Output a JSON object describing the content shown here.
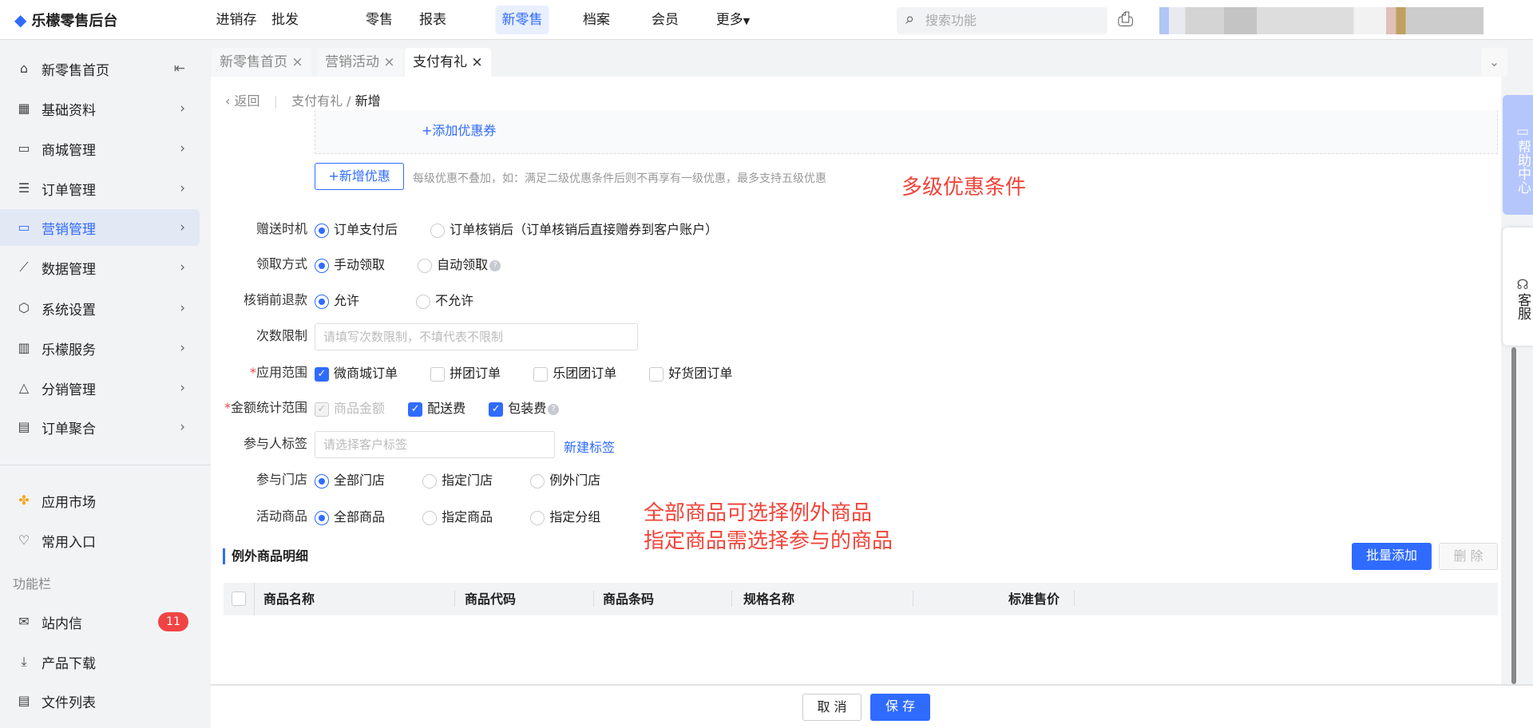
{
  "header": {
    "logo": "乐檬零售后台",
    "nav": [
      "进销存",
      "批发",
      "零售",
      "报表",
      "新零售",
      "档案",
      "会员",
      "更多"
    ],
    "active_nav": "新零售",
    "search_placeholder": "搜索功能"
  },
  "sidebar": {
    "items": [
      {
        "label": "新零售首页",
        "icon": "home-icon"
      },
      {
        "label": "基础资料",
        "icon": "grid-icon"
      },
      {
        "label": "商城管理",
        "icon": "store-icon"
      },
      {
        "label": "订单管理",
        "icon": "list-icon"
      },
      {
        "label": "营销管理",
        "icon": "monitor-icon"
      },
      {
        "label": "数据管理",
        "icon": "chart-icon"
      },
      {
        "label": "系统设置",
        "icon": "settings-icon"
      },
      {
        "label": "乐檬服务",
        "icon": "briefcase-icon"
      },
      {
        "label": "分销管理",
        "icon": "share-icon"
      },
      {
        "label": "订单聚合",
        "icon": "aggregate-icon"
      }
    ],
    "active": "营销管理",
    "extra": [
      {
        "label": "应用市场"
      },
      {
        "label": "常用入口"
      }
    ],
    "section": "功能栏",
    "tools": [
      {
        "label": "站内信",
        "badge": "11"
      },
      {
        "label": "产品下载"
      },
      {
        "label": "文件列表"
      }
    ]
  },
  "tabs": [
    {
      "label": "新零售首页"
    },
    {
      "label": "营销活动"
    },
    {
      "label": "支付有礼"
    }
  ],
  "breadcrumb": {
    "back": "返回",
    "parent": "支付有礼",
    "current": "新增"
  },
  "coupon": {
    "add_coupon": "+添加优惠券",
    "add_discount": "+新增优惠",
    "hint": "每级优惠不叠加，如：满足二级优惠条件后则不再享有一级优惠，最多支持五级优惠"
  },
  "annotations": {
    "a1": "多级优惠条件",
    "a2": "全部商品可选择例外商品",
    "a3": "指定商品需选择参与的商品"
  },
  "form": {
    "gift_timing": {
      "label": "赠送时机",
      "options": [
        "订单支付后",
        "订单核销后（订单核销后直接赠券到客户账户）"
      ],
      "selected": 0
    },
    "claim_method": {
      "label": "领取方式",
      "options": [
        "手动领取",
        "自动领取"
      ],
      "selected": 0
    },
    "refund": {
      "label": "核销前退款",
      "options": [
        "允许",
        "不允许"
      ],
      "selected": 0
    },
    "limit": {
      "label": "次数限制",
      "placeholder": "请填写次数限制，不填代表不限制"
    },
    "scope": {
      "label": "应用范围",
      "options": [
        "微商城订单",
        "拼团订单",
        "乐团团订单",
        "好货团订单"
      ],
      "checked": [
        true,
        false,
        false,
        false
      ]
    },
    "amount": {
      "label": "金额统计范围",
      "options": [
        "商品金额",
        "配送费",
        "包装费"
      ],
      "checked": [
        true,
        true,
        true
      ]
    },
    "tags": {
      "label": "参与人标签",
      "placeholder": "请选择客户标签",
      "new_tag": "新建标签"
    },
    "stores": {
      "label": "参与门店",
      "options": [
        "全部门店",
        "指定门店",
        "例外门店"
      ],
      "selected": 0
    },
    "goods": {
      "label": "活动商品",
      "options": [
        "全部商品",
        "指定商品",
        "指定分组"
      ],
      "selected": 0
    }
  },
  "section": {
    "title": "例外商品明细",
    "batch_add": "批量添加",
    "delete": "删 除",
    "columns": [
      "商品名称",
      "商品代码",
      "商品条码",
      "规格名称",
      "标准售价"
    ]
  },
  "footer": {
    "cancel": "取 消",
    "save": "保 存"
  },
  "float": {
    "help": "帮助中心",
    "service": "客服"
  },
  "colors": {
    "primary": "#2f6bff",
    "annotation": "#f0443a"
  }
}
